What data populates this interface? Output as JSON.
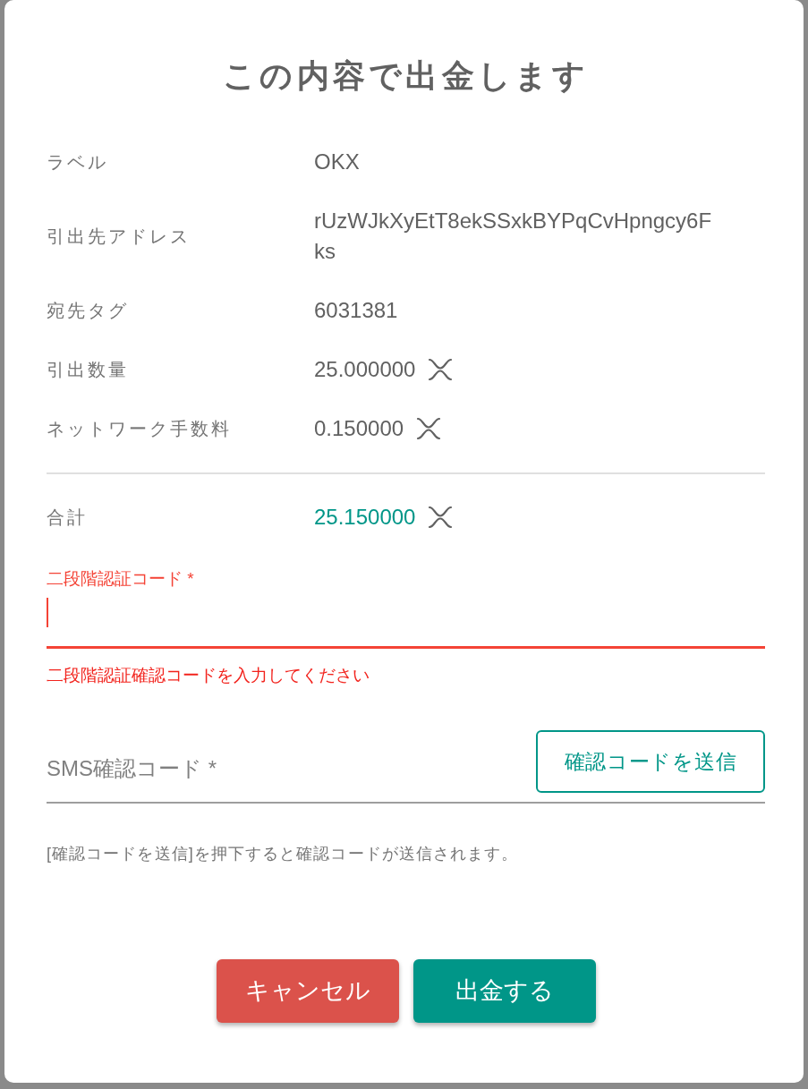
{
  "dialog": {
    "title": "この内容で出金します"
  },
  "details": [
    {
      "label": "ラベル",
      "value": "OKX",
      "kind": "text"
    },
    {
      "label": "引出先アドレス",
      "value": "rUzWJkXyEtT8ekSSxkBYPqCvHpngcy6Fks",
      "kind": "text"
    },
    {
      "label": "宛先タグ",
      "value": "6031381",
      "kind": "text"
    },
    {
      "label": "引出数量",
      "value": "25.000000",
      "kind": "amount"
    },
    {
      "label": "ネットワーク手数料",
      "value": "0.150000",
      "kind": "amount"
    }
  ],
  "total": {
    "label": "合計",
    "value": "25.150000",
    "kind": "amount"
  },
  "two_factor_field": {
    "label": "二段階認証コード *",
    "focused": true,
    "error": "二段階認証確認コードを入力してください"
  },
  "sms_field": {
    "placeholder": "SMS確認コード *",
    "send_button": "確認コードを送信"
  },
  "hint": "[確認コードを送信]を押下すると確認コードが送信されます。",
  "buttons": [
    {
      "label": "キャンセル",
      "kind": "cancel"
    },
    {
      "label": "出金する",
      "kind": "submit"
    }
  ]
}
